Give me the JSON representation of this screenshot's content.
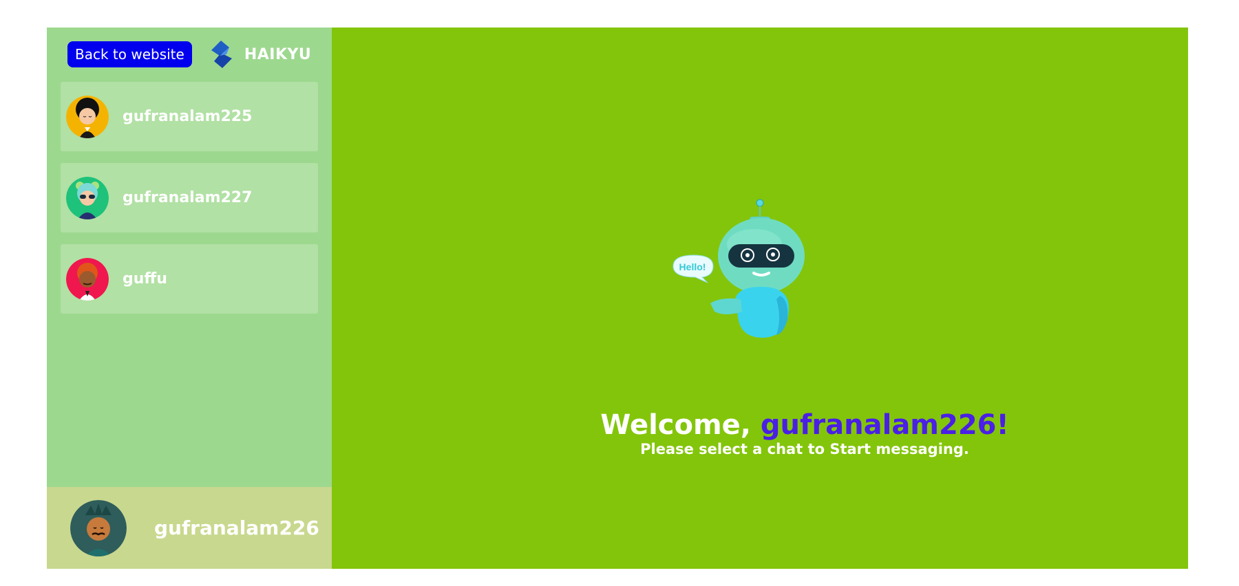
{
  "header": {
    "back_label": "Back to website",
    "brand": "HAIKYU"
  },
  "contacts": [
    {
      "name": "gufranalam225",
      "avatar_bg": "#f5b301"
    },
    {
      "name": "gufranalam227",
      "avatar_bg": "#1ec27a"
    },
    {
      "name": "guffu",
      "avatar_bg": "#f0164e"
    }
  ],
  "current_user": {
    "name": "gufranalam226",
    "avatar_bg": "#2e5d5b"
  },
  "welcome": {
    "greeting": "Welcome, ",
    "username": "gufranalam226",
    "exclaim": "!",
    "subtitle": "Please select a chat to Start messaging."
  },
  "robot": {
    "bubble_text": "Hello!"
  },
  "colors": {
    "sidebar": "#9dd88f",
    "main": "#83c50b",
    "button": "#0000ee",
    "accent": "#4a1fe6"
  }
}
